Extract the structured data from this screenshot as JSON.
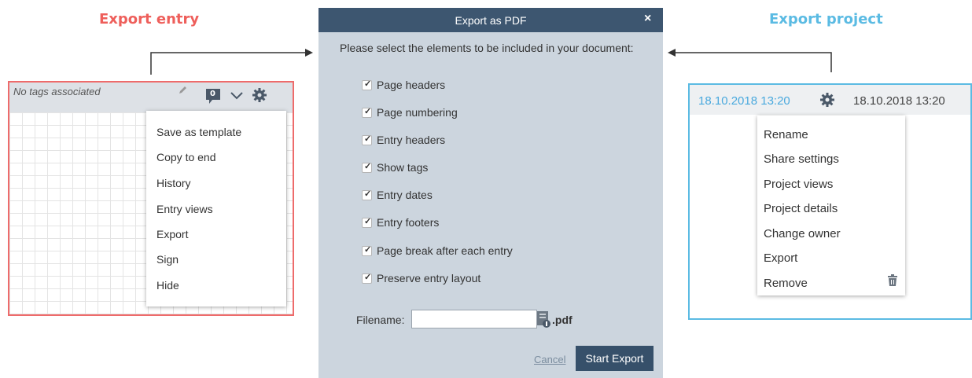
{
  "headings": {
    "entry": "Export entry",
    "project": "Export project"
  },
  "entry_panel": {
    "tags_text": "No tags associated",
    "comment_count": "0",
    "icons": [
      "pencil-icon",
      "comment-icon",
      "chevron-down-icon",
      "gear-icon"
    ],
    "menu": [
      "Save as template",
      "Copy to end",
      "History",
      "Entry views",
      "Export",
      "Sign",
      "Hide"
    ]
  },
  "dialog": {
    "title": "Export as PDF",
    "close": "×",
    "intro": "Please select the elements to be included in your document:",
    "options": [
      {
        "label": "Page headers",
        "checked": true
      },
      {
        "label": "Page numbering",
        "checked": true
      },
      {
        "label": "Entry headers",
        "checked": true
      },
      {
        "label": "Show tags",
        "checked": true
      },
      {
        "label": "Entry dates",
        "checked": true
      },
      {
        "label": "Entry footers",
        "checked": true
      },
      {
        "label": "Page break after each entry",
        "checked": true
      },
      {
        "label": "Preserve entry layout",
        "checked": true
      }
    ],
    "filename_label": "Filename:",
    "filename_value": "",
    "extension": ".pdf",
    "cancel": "Cancel",
    "start": "Start Export"
  },
  "project_panel": {
    "date_left": "18.10.2018 13:20",
    "date_right": "18.10.2018 13:20",
    "menu": [
      "Rename",
      "Share settings",
      "Project views",
      "Project details",
      "Change owner",
      "Export",
      "Remove"
    ]
  },
  "colors": {
    "entry_accent": "#ee5f5b",
    "project_accent": "#5bbbe3",
    "dialog_header": "#3d5670",
    "dialog_body": "#ccd5de",
    "button": "#36506a"
  }
}
